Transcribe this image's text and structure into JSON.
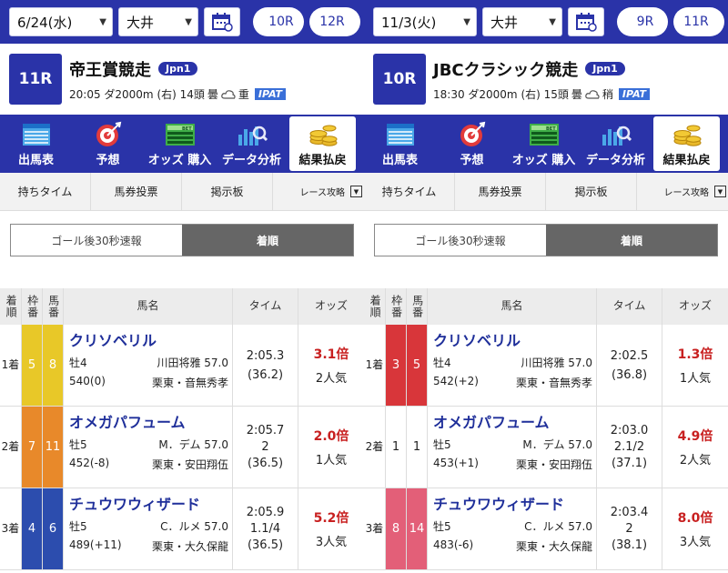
{
  "icons": {
    "calendar": "calendar-icon",
    "dropdown": "chevron-down-icon"
  },
  "colors": {
    "brand": "#2a33a8",
    "ipat": "#3a6fd8",
    "odds": "#c82020",
    "link": "#1f2f9a"
  },
  "panels": [
    {
      "nav": {
        "date": "6/24(水)",
        "venue": "大井",
        "prev": "10R",
        "next": "12R"
      },
      "race": {
        "num": "11R",
        "name": "帝王賞競走",
        "grade": "Jpn1",
        "time_dist": "20:05 ダ2000m (右) 14頭",
        "weather": "曇",
        "track": "重",
        "ipat": "IPAT"
      },
      "menu": [
        "出馬表",
        "予想",
        "オッズ 購入",
        "データ分析",
        "結果払戻"
      ],
      "subtabs": [
        "持ちタイム",
        "馬券投票",
        "掲示板",
        "レース攻略"
      ],
      "segment": [
        "ゴール後30秒速報",
        "着順"
      ],
      "headers": {
        "rank": "着順",
        "waku": "枠番",
        "ban": "馬番",
        "name": "馬名",
        "time": "タイム",
        "odds": "オッズ"
      },
      "rows": [
        {
          "rank": "1着",
          "waku": "5",
          "ban": "8",
          "wcolor": "#e8c828",
          "bcolor": "#e8c828",
          "name": "クリソベリル",
          "sexage": "牡4",
          "jockey": "川田将雅 57.0",
          "weight": "540(0)",
          "trainer": "栗東・音無秀孝",
          "time": "2:05.3",
          "margin": "",
          "last": "(36.2)",
          "odds": "3.1倍",
          "pop": "2人気"
        },
        {
          "rank": "2着",
          "waku": "7",
          "ban": "11",
          "wcolor": "#e8892a",
          "bcolor": "#e8892a",
          "name": "オメガパフューム",
          "sexage": "牡5",
          "jockey": "M．デム 57.0",
          "weight": "452(-8)",
          "trainer": "栗東・安田翔伍",
          "time": "2:05.7",
          "margin": "2",
          "last": "(36.5)",
          "odds": "2.0倍",
          "pop": "1人気"
        },
        {
          "rank": "3着",
          "waku": "4",
          "ban": "6",
          "wcolor": "#2c4dae",
          "bcolor": "#2c4dae",
          "name": "チュウワウィザード",
          "sexage": "牡5",
          "jockey": "C．ルメ 57.0",
          "weight": "489(+11)",
          "trainer": "栗東・大久保龍",
          "time": "2:05.9",
          "margin": "1.1/4",
          "last": "(36.5)",
          "odds": "5.2倍",
          "pop": "3人気"
        }
      ]
    },
    {
      "nav": {
        "date": "11/3(火)",
        "venue": "大井",
        "prev": "9R",
        "next": "11R"
      },
      "race": {
        "num": "10R",
        "name": "JBCクラシック競走",
        "grade": "Jpn1",
        "time_dist": "18:30 ダ2000m (右) 15頭",
        "weather": "曇",
        "track": "稍",
        "ipat": "IPAT"
      },
      "menu": [
        "出馬表",
        "予想",
        "オッズ 購入",
        "データ分析",
        "結果払戻"
      ],
      "subtabs": [
        "持ちタイム",
        "馬券投票",
        "掲示板",
        "レース攻略"
      ],
      "segment": [
        "ゴール後30秒速報",
        "着順"
      ],
      "headers": {
        "rank": "着順",
        "waku": "枠番",
        "ban": "馬番",
        "name": "馬名",
        "time": "タイム",
        "odds": "オッズ"
      },
      "rows": [
        {
          "rank": "1着",
          "waku": "3",
          "ban": "5",
          "wcolor": "#d8363a",
          "bcolor": "#d8363a",
          "name": "クリソベリル",
          "sexage": "牡4",
          "jockey": "川田将雅 57.0",
          "weight": "542(+2)",
          "trainer": "栗東・音無秀孝",
          "time": "2:02.5",
          "margin": "",
          "last": "(36.8)",
          "odds": "1.3倍",
          "pop": "1人気"
        },
        {
          "rank": "2着",
          "waku": "1",
          "ban": "1",
          "wcolor": "#ffffff",
          "bcolor": "#ffffff",
          "name": "オメガパフューム",
          "sexage": "牡5",
          "jockey": "M．デム 57.0",
          "weight": "453(+1)",
          "trainer": "栗東・安田翔伍",
          "time": "2:03.0",
          "margin": "2.1/2",
          "last": "(37.1)",
          "odds": "4.9倍",
          "pop": "2人気"
        },
        {
          "rank": "3着",
          "waku": "8",
          "ban": "14",
          "wcolor": "#e35f78",
          "bcolor": "#e35f78",
          "name": "チュウワウィザード",
          "sexage": "牡5",
          "jockey": "C．ルメ 57.0",
          "weight": "483(-6)",
          "trainer": "栗東・大久保龍",
          "time": "2:03.4",
          "margin": "2",
          "last": "(38.1)",
          "odds": "8.0倍",
          "pop": "3人気"
        }
      ]
    }
  ]
}
